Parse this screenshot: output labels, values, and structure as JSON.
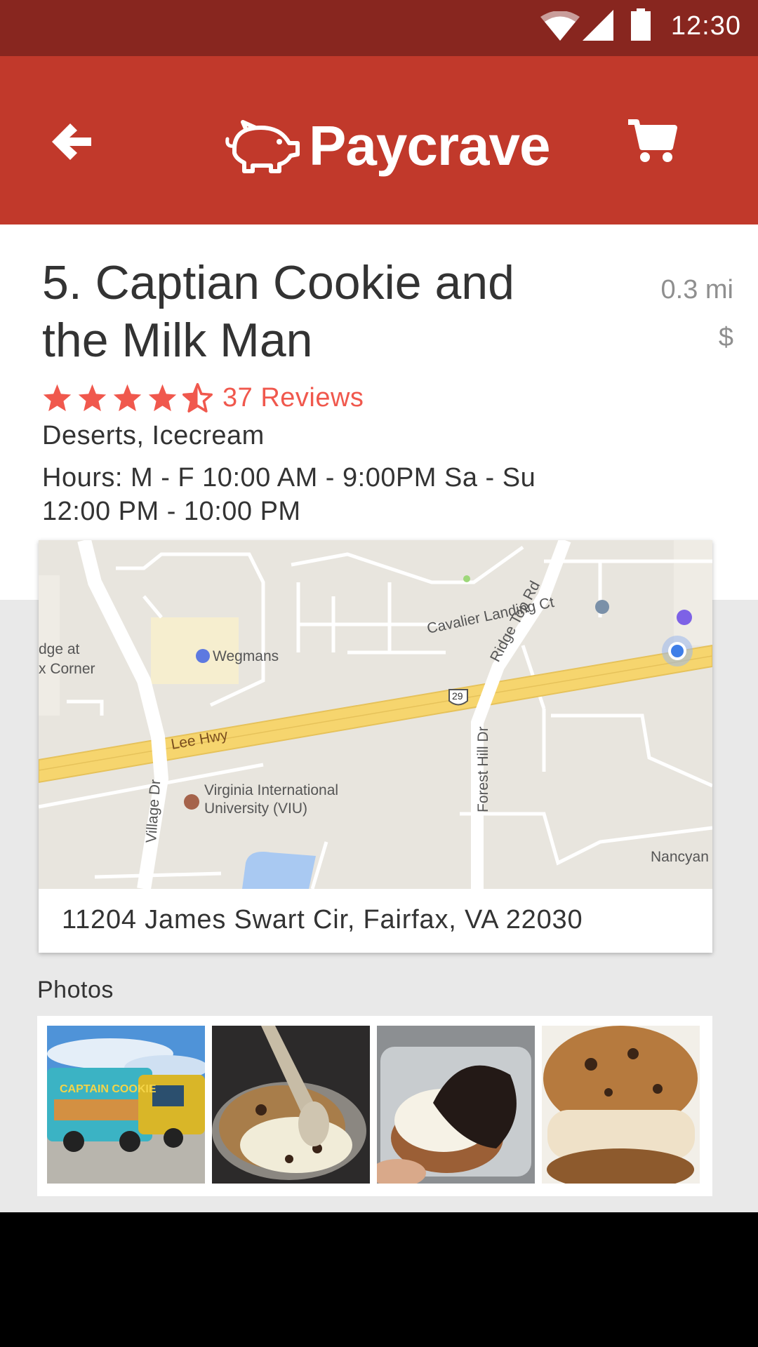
{
  "status_bar": {
    "time": "12:30"
  },
  "app_bar": {
    "brand": "Paycrave"
  },
  "restaurant": {
    "title": "5. Captian Cookie and the Milk Man",
    "distance": "0.3 mi",
    "price": "$",
    "rating": 4.5,
    "reviews": "37 Reviews",
    "categories": "Deserts, Icecream",
    "hours": "Hours: M - F 10:00 AM - 9:00PM   Sa - Su 12:00 PM - 10:00 PM",
    "address": "11204 James Swart Cir, Fairfax, VA 22030"
  },
  "map": {
    "labels": {
      "wegmans": "Wegmans",
      "edge_line1": "dge at",
      "edge_line2": "x Corner",
      "cavalier": "Cavalier Landing Ct",
      "ridge": "Ridge Top Rd",
      "route": "29",
      "lee_hwy": "Lee Hwy",
      "village": "Village Dr",
      "viu_line1": "Virginia International",
      "viu_line2": "University (VIU)",
      "forest": "Forest Hill Dr",
      "nancy": "Nancyan"
    }
  },
  "photos": {
    "label": "Photos",
    "items": [
      {
        "name": "food-truck-photo",
        "truck_text": "CAPTAIN COOKIE"
      },
      {
        "name": "cookie-icecream-spoon-photo"
      },
      {
        "name": "chocolate-cookie-sandwich-photo"
      },
      {
        "name": "icecream-cookie-sandwich-photo"
      }
    ]
  },
  "colors": {
    "status_bar": "#88261f",
    "app_bar": "#c1392b",
    "accent": "#f0584d"
  }
}
